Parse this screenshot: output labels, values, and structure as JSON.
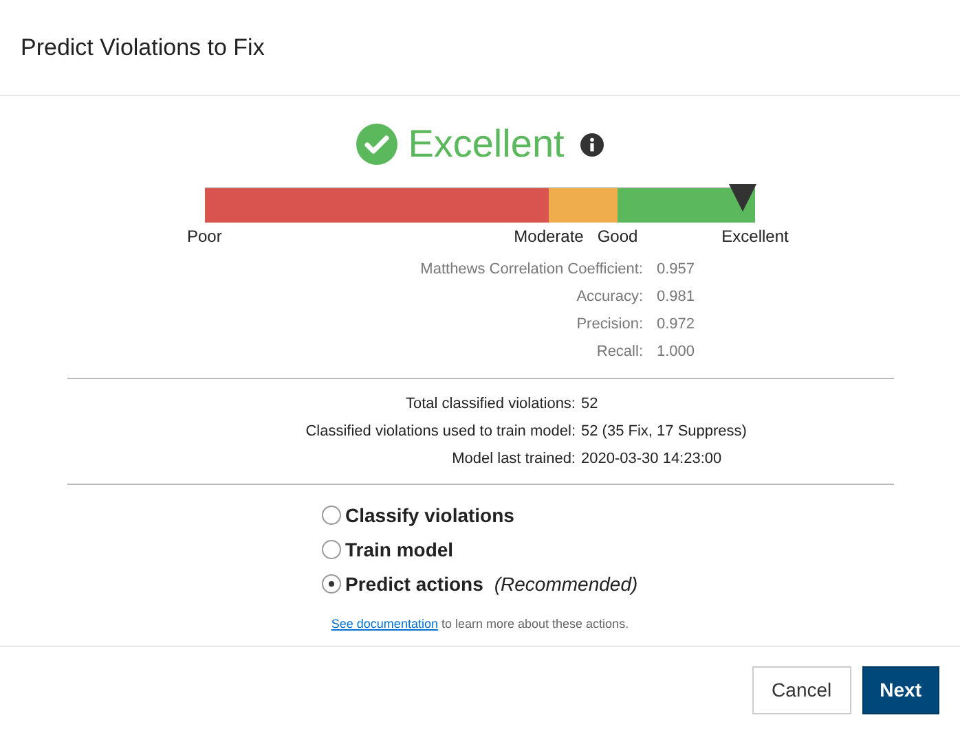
{
  "dialog": {
    "title": "Predict Violations to Fix"
  },
  "rating": {
    "label": "Excellent"
  },
  "gauge": {
    "segments": [
      {
        "color": "#d9534f"
      },
      {
        "color": "#f0ad4e"
      },
      {
        "color": "#5cb85c"
      }
    ],
    "labels": [
      "Poor",
      "Moderate",
      "Good",
      "Excellent"
    ]
  },
  "metrics": [
    {
      "label": "Matthews Correlation Coefficient:",
      "value": "0.957"
    },
    {
      "label": "Accuracy:",
      "value": "0.981"
    },
    {
      "label": "Precision:",
      "value": "0.972"
    },
    {
      "label": "Recall:",
      "value": "1.000"
    }
  ],
  "stats": [
    {
      "label": "Total classified violations:",
      "value": "52"
    },
    {
      "label": "Classified violations used to train model:",
      "value": "52 (35 Fix, 17 Suppress)"
    },
    {
      "label": "Model last trained:",
      "value": "2020-03-30 14:23:00"
    }
  ],
  "options": [
    {
      "label": "Classify violations",
      "selected": false
    },
    {
      "label": "Train model",
      "selected": false
    },
    {
      "label": "Predict actions",
      "note": "(Recommended)",
      "selected": true
    }
  ],
  "help": {
    "link": "See documentation",
    "text": "to learn more about these actions."
  },
  "buttons": [
    {
      "label": "Cancel",
      "kind": "secondary"
    },
    {
      "label": "Next",
      "kind": "primary"
    }
  ]
}
